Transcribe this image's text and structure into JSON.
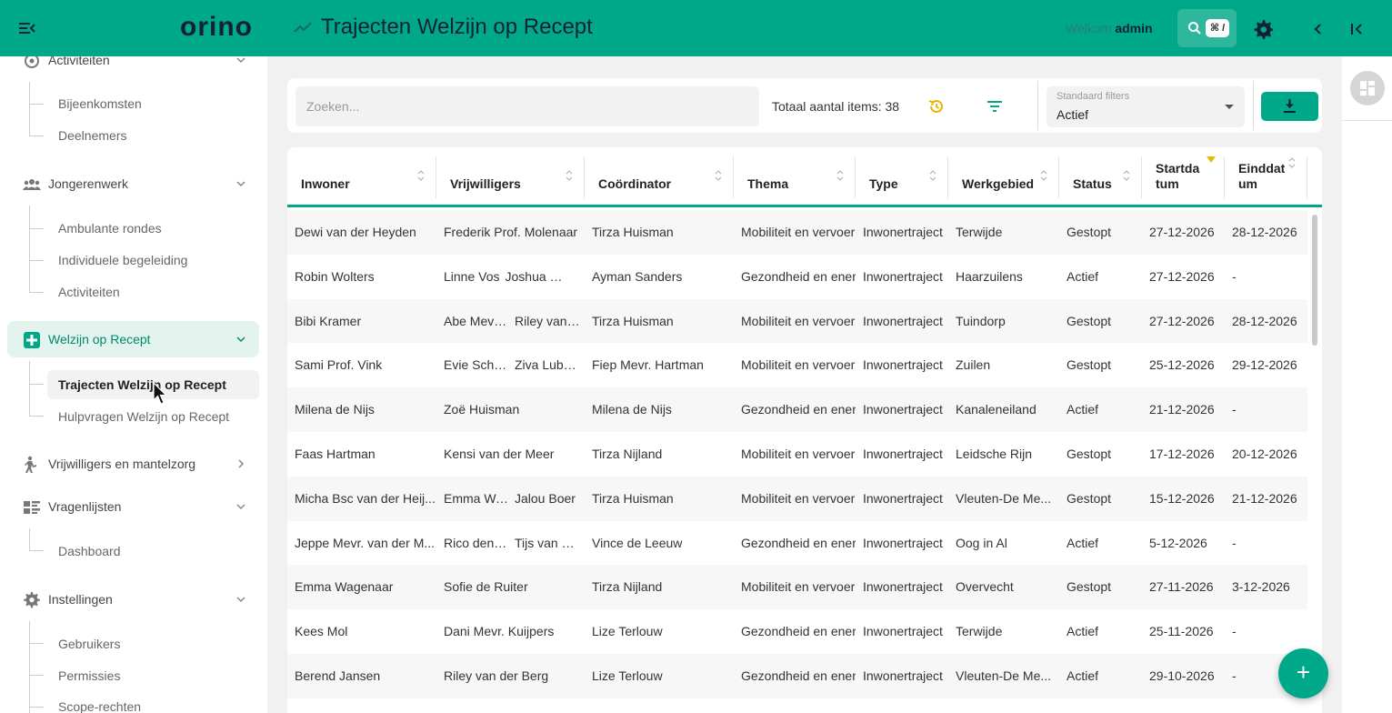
{
  "header": {
    "logo": "orino",
    "title": "Trajecten Welzijn op Recept",
    "welcome_text": "Welkom",
    "username": "admin",
    "search_shortcut": "⌘ /"
  },
  "sidebar": {
    "groups": [
      {
        "label": "Activiteiten",
        "icon": "activity-icon"
      },
      {
        "label": "Jongerenwerk",
        "icon": "people-icon"
      },
      {
        "label": "Welzijn op Recept",
        "icon": "plus-square-icon"
      },
      {
        "label": "Vrijwilligers en mantelzorg",
        "icon": "volunteer-icon"
      },
      {
        "label": "Vragenlijsten",
        "icon": "questionnaire-icon"
      },
      {
        "label": "Instellingen",
        "icon": "gear-icon"
      }
    ],
    "items": {
      "bijeenkomsten": "Bijeenkomsten",
      "deelnemers": "Deelnemers",
      "ambulante_rondes": "Ambulante rondes",
      "individuele_begeleiding": "Individuele begeleiding",
      "activiteiten": "Activiteiten",
      "trajecten": "Trajecten Welzijn op Recept",
      "hulpvragen": "Hulpvragen Welzijn op Recept",
      "dashboard": "Dashboard",
      "gebruikers": "Gebruikers",
      "permissies": "Permissies",
      "scope_rechten": "Scope-rechten"
    }
  },
  "toolbar": {
    "search_placeholder": "Zoeken...",
    "total_label": "Totaal aantal items: 38",
    "standard_filters_label": "Standaard filters",
    "standard_filters_value": "Actief"
  },
  "table": {
    "headers": {
      "inwoner": "Inwoner",
      "vrijwilligers": "Vrijwilligers",
      "coordinator": "Coördinator",
      "thema": "Thema",
      "type": "Type",
      "werkgebied": "Werkgebied",
      "status": "Status",
      "startdatum_1": "Startda",
      "startdatum_2": "tum",
      "einddatum_1": "Einddat",
      "einddatum_2": "um"
    },
    "rows": [
      {
        "inwoner": "Dewi van der Heyden",
        "vrijwilligers": [
          "Frederik Prof. Molenaar"
        ],
        "coordinator": "Tirza Huisman",
        "thema": "Mobiliteit en vervoer",
        "type": "Inwonertraject",
        "werkgebied": "Terwijde",
        "status": "Gestopt",
        "start": "27-12-2026",
        "eind": "28-12-2026"
      },
      {
        "inwoner": "Robin Wolters",
        "vrijwilligers": [
          "Linne Vos",
          "Joshua Ms..."
        ],
        "coordinator": "Ayman Sanders",
        "thema": "Gezondheid en energie",
        "type": "Inwonertraject",
        "werkgebied": "Haarzuilens",
        "status": "Actief",
        "start": "27-12-2026",
        "eind": "-"
      },
      {
        "inwoner": "Bibi Kramer",
        "vrijwilligers": [
          "Abe Mevr. ...",
          "Riley van ..."
        ],
        "coordinator": "Tirza Huisman",
        "thema": "Mobiliteit en vervoer",
        "type": "Inwonertraject",
        "werkgebied": "Tuindorp",
        "status": "Gestopt",
        "start": "27-12-2026",
        "eind": "28-12-2026"
      },
      {
        "inwoner": "Sami Prof. Vink",
        "vrijwilligers": [
          "Evie Schip...",
          "Ziva Lubb..."
        ],
        "coordinator": "Fiep Mevr. Hartman",
        "thema": "Mobiliteit en vervoer",
        "type": "Inwonertraject",
        "werkgebied": "Zuilen",
        "status": "Gestopt",
        "start": "25-12-2026",
        "eind": "29-12-2026"
      },
      {
        "inwoner": "Milena de Nijs",
        "vrijwilligers": [
          "Zoë Huisman"
        ],
        "coordinator": "Milena de Nijs",
        "thema": "Gezondheid en energie",
        "type": "Inwonertraject",
        "werkgebied": "Kanaleneiland",
        "status": "Actief",
        "start": "21-12-2026",
        "eind": "-"
      },
      {
        "inwoner": "Faas Hartman",
        "vrijwilligers": [
          "Kensi van der Meer"
        ],
        "coordinator": "Tirza Nijland",
        "thema": "Mobiliteit en vervoer",
        "type": "Inwonertraject",
        "werkgebied": "Leidsche Rijn",
        "status": "Gestopt",
        "start": "17-12-2026",
        "eind": "20-12-2026"
      },
      {
        "inwoner": "Micha Bsc van der Heij...",
        "vrijwilligers": [
          "Emma Wa...",
          "Jalou Boer"
        ],
        "coordinator": "Tirza Huisman",
        "thema": "Mobiliteit en vervoer",
        "type": "Inwonertraject",
        "werkgebied": "Vleuten-De Me...",
        "status": "Gestopt",
        "start": "15-12-2026",
        "eind": "21-12-2026"
      },
      {
        "inwoner": "Jeppe Mevr. van der M...",
        "vrijwilligers": [
          "Rico den A...",
          "Tijs van de..."
        ],
        "coordinator": "Vince de Leeuw",
        "thema": "Gezondheid en energie",
        "type": "Inwonertraject",
        "werkgebied": "Oog in Al",
        "status": "Actief",
        "start": "5-12-2026",
        "eind": "-"
      },
      {
        "inwoner": "Emma Wagenaar",
        "vrijwilligers": [
          "Sofie de Ruiter"
        ],
        "coordinator": "Tirza Nijland",
        "thema": "Mobiliteit en vervoer",
        "type": "Inwonertraject",
        "werkgebied": "Overvecht",
        "status": "Gestopt",
        "start": "27-11-2026",
        "eind": "3-12-2026"
      },
      {
        "inwoner": "Kees Mol",
        "vrijwilligers": [
          "Dani Mevr. Kuijpers"
        ],
        "coordinator": "Lize Terlouw",
        "thema": "Gezondheid en energie",
        "type": "Inwonertraject",
        "werkgebied": "Terwijde",
        "status": "Actief",
        "start": "25-11-2026",
        "eind": "-"
      },
      {
        "inwoner": "Berend Jansen",
        "vrijwilligers": [
          "Riley van der Berg"
        ],
        "coordinator": "Lize Terlouw",
        "thema": "Gezondheid en energie",
        "type": "Inwonertraject",
        "werkgebied": "Vleuten-De Me...",
        "status": "Actief",
        "start": "29-10-2026",
        "eind": "-"
      }
    ]
  },
  "fab_label": "+",
  "colors": {
    "brand": "#00a88a",
    "brand_text": "#112233",
    "active_bg": "#e3f4ef",
    "sort_indicator": "#e0bf00",
    "reset_icon": "#e8b400"
  }
}
